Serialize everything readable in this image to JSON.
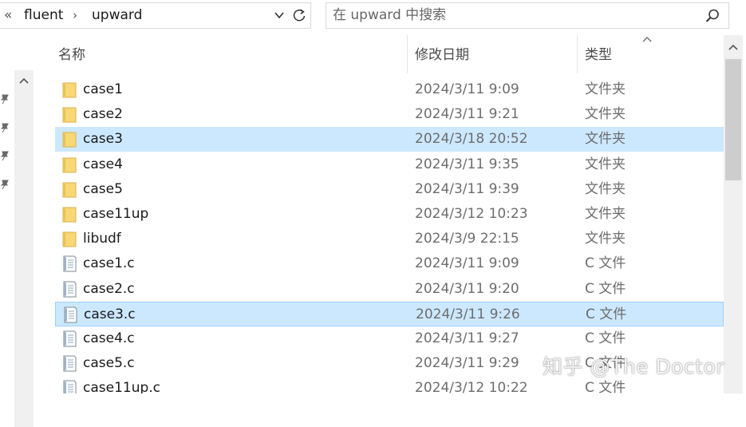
{
  "address_bar": {
    "overflow_glyph": "«",
    "crumbs": [
      "fluent",
      "upward"
    ],
    "separator_glyph": "›",
    "dropdown_icon": "chevron-down-icon",
    "refresh_icon": "refresh-icon"
  },
  "search": {
    "placeholder": "在 upward 中搜索",
    "icon": "search-icon"
  },
  "columns": {
    "name": "名称",
    "modified": "修改日期",
    "type": "类型",
    "sort_indicator": "sort-ascending-icon"
  },
  "files": [
    {
      "name": "case1",
      "modified": "2024/3/11 9:09",
      "type": "文件夹",
      "kind": "folder",
      "selected": false
    },
    {
      "name": "case2",
      "modified": "2024/3/11 9:21",
      "type": "文件夹",
      "kind": "folder",
      "selected": false
    },
    {
      "name": "case3",
      "modified": "2024/3/18 20:52",
      "type": "文件夹",
      "kind": "folder",
      "selected": true
    },
    {
      "name": "case4",
      "modified": "2024/3/11 9:35",
      "type": "文件夹",
      "kind": "folder",
      "selected": false
    },
    {
      "name": "case5",
      "modified": "2024/3/11 9:39",
      "type": "文件夹",
      "kind": "folder",
      "selected": false
    },
    {
      "name": "case11up",
      "modified": "2024/3/12 10:23",
      "type": "文件夹",
      "kind": "folder",
      "selected": false
    },
    {
      "name": "libudf",
      "modified": "2024/3/9 22:15",
      "type": "文件夹",
      "kind": "folder",
      "selected": false
    },
    {
      "name": "case1.c",
      "modified": "2024/3/11 9:09",
      "type": "C 文件",
      "kind": "c-file",
      "selected": false
    },
    {
      "name": "case2.c",
      "modified": "2024/3/11 9:20",
      "type": "C 文件",
      "kind": "c-file",
      "selected": false
    },
    {
      "name": "case3.c",
      "modified": "2024/3/11 9:26",
      "type": "C 文件",
      "kind": "c-file",
      "selected": true
    },
    {
      "name": "case4.c",
      "modified": "2024/3/11 9:27",
      "type": "C 文件",
      "kind": "c-file",
      "selected": false
    },
    {
      "name": "case5.c",
      "modified": "2024/3/11 9:29",
      "type": "C 文件",
      "kind": "c-file",
      "selected": false
    },
    {
      "name": "case11up.c",
      "modified": "2024/3/12 10:22",
      "type": "C 文件",
      "kind": "c-file",
      "selected": false
    }
  ],
  "quick_access_pins": [
    "pin-icon",
    "pin-icon",
    "pin-icon",
    "pin-icon"
  ],
  "watermark": "知乎 @The Doctor",
  "colors": {
    "selection_bg": "#cce8ff",
    "selection_border": "#99d1ff",
    "folder_yellow": "#f8d775",
    "scrollbar_thumb": "#cdcdcd"
  }
}
